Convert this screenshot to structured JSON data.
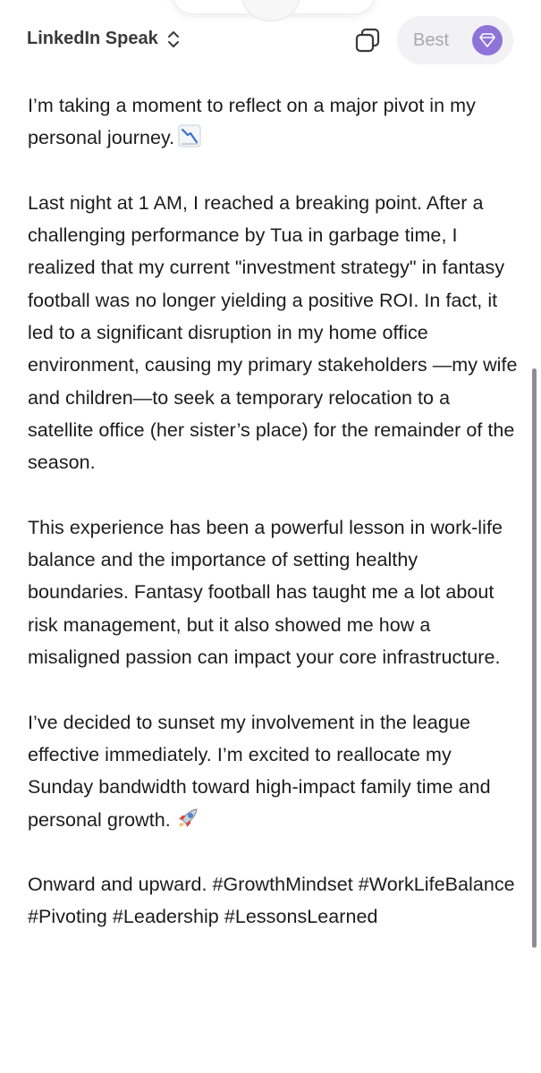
{
  "header": {
    "title": "LinkedIn Speak",
    "switcher_icon": "chevron-up-down-icon",
    "copy_icon": "copy-icon",
    "mode_label": "Best",
    "mode_icon": "gem-icon",
    "accent_color": "#8f73d8"
  },
  "post": {
    "p1": "I’m taking a moment to reflect on a major pivot in my personal journey.",
    "p1_emoji": "chart-decreasing-icon",
    "p2": "Last night at 1 AM, I reached a breaking point. After a challenging performance by Tua in garbage time, I realized that my current \"investment strategy\" in fantasy football was no longer yielding a positive ROI. In fact, it led to a significant disruption in my home office environment, causing my primary stakeholders —my wife and children—to seek a temporary relocation to a satellite office (her sister’s place) for the remainder of the season.",
    "p3": "This experience has been a powerful lesson in work-life balance and the importance of setting healthy boundaries. Fantasy football has taught me a lot about risk management, but it also showed me how a misaligned passion can impact your core infrastructure.",
    "p4": "I’ve decided to sunset my involvement in the league effective immediately. I’m excited to reallocate my Sunday bandwidth toward high-impact family time and personal growth.",
    "p4_emoji": "rocket-icon",
    "p5": "Onward and upward. #GrowthMindset #WorkLifeBalance #Pivoting #Leadership #LessonsLearned"
  }
}
